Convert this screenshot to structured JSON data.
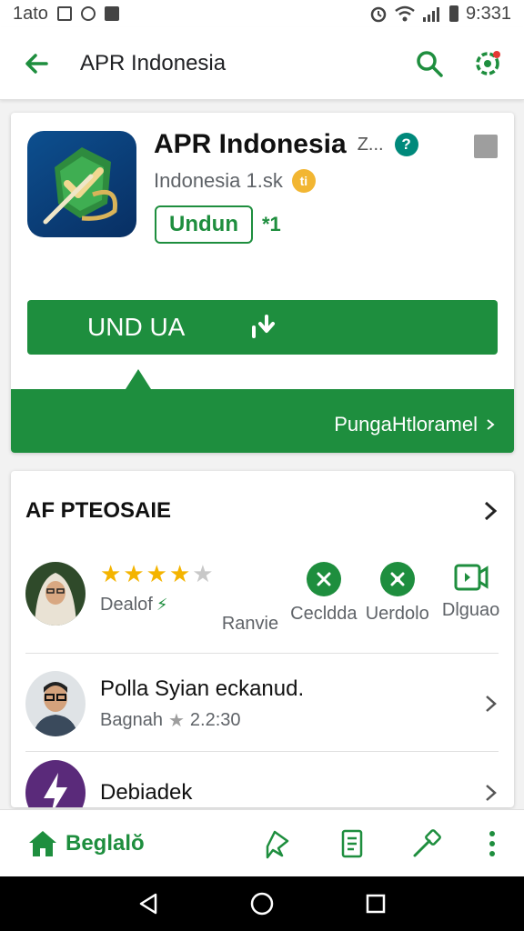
{
  "status_bar": {
    "left_text": "1ato",
    "time": "9:331"
  },
  "app_bar": {
    "title": "APR Indonesia",
    "icons": [
      "back-arrow-icon",
      "search-icon",
      "settings-icon"
    ]
  },
  "app_header": {
    "name": "APR Indonesia",
    "name_extra": "Z...",
    "verified_symbol": "?",
    "developer": "Indonesia 1.sk",
    "age_badge": "ti",
    "chip_label": "Undun",
    "chip_extra": "*1",
    "install_label": "UND UA",
    "band_link": "PungaHtloramel"
  },
  "section": {
    "title": "AF PTEOSAIE",
    "rating": {
      "stars_filled": 4,
      "stars_total": 5,
      "label": "Dealof"
    },
    "stats": [
      {
        "label": "Ranvie",
        "icon": "none"
      },
      {
        "label": "Cecldda",
        "icon": "chat-x-icon"
      },
      {
        "label": "Uerdolo",
        "icon": "leaf-x-icon"
      },
      {
        "label": "Dlguao",
        "icon": "video-icon"
      }
    ],
    "list": [
      {
        "title": "Polla Syian eckanud.",
        "sub_prefix": "Bagnah",
        "sub_value": "2.2:30",
        "avatar": "man-glasses"
      },
      {
        "title": "Debiadek",
        "sub_prefix": "",
        "sub_value": "",
        "avatar": "purple-bolt"
      }
    ]
  },
  "bottom_nav": {
    "home_label": "Beglalŏ",
    "icons": [
      "pin-icon",
      "document-icon",
      "tool-icon",
      "more-vert-icon"
    ]
  },
  "colors": {
    "primary_green": "#1e8e3e",
    "icon_blue": "#0d4f8f",
    "star_gold": "#f4b400"
  }
}
